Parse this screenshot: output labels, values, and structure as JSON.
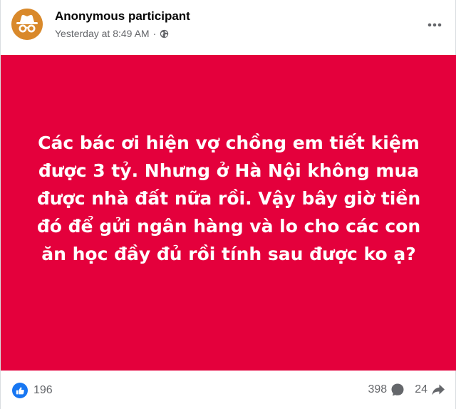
{
  "post": {
    "author": "Anonymous participant",
    "timestamp": "Yesterday at 8:49 AM",
    "separator": "·",
    "privacy_icon": "globe-icon",
    "avatar_icon": "anonymous-incognito-icon",
    "more_icon": "more-horizontal-icon",
    "banner_color": "#e4003c",
    "banner_text": "Các bác ơi hiện vợ chồng em tiết kiệm được 3 tỷ. Nhưng ở Hà Nội không mua được nhà đất nữa rồi. Vậy bây giờ tiền đó để gửi ngân hàng và lo cho các con ăn học đầy đủ rồi tính sau được ko ạ?"
  },
  "footer": {
    "reactions_count": "196",
    "reaction_icon": "like-icon",
    "comments_count": "398",
    "comment_icon": "comment-icon",
    "shares_count": "24",
    "share_icon": "share-icon"
  }
}
